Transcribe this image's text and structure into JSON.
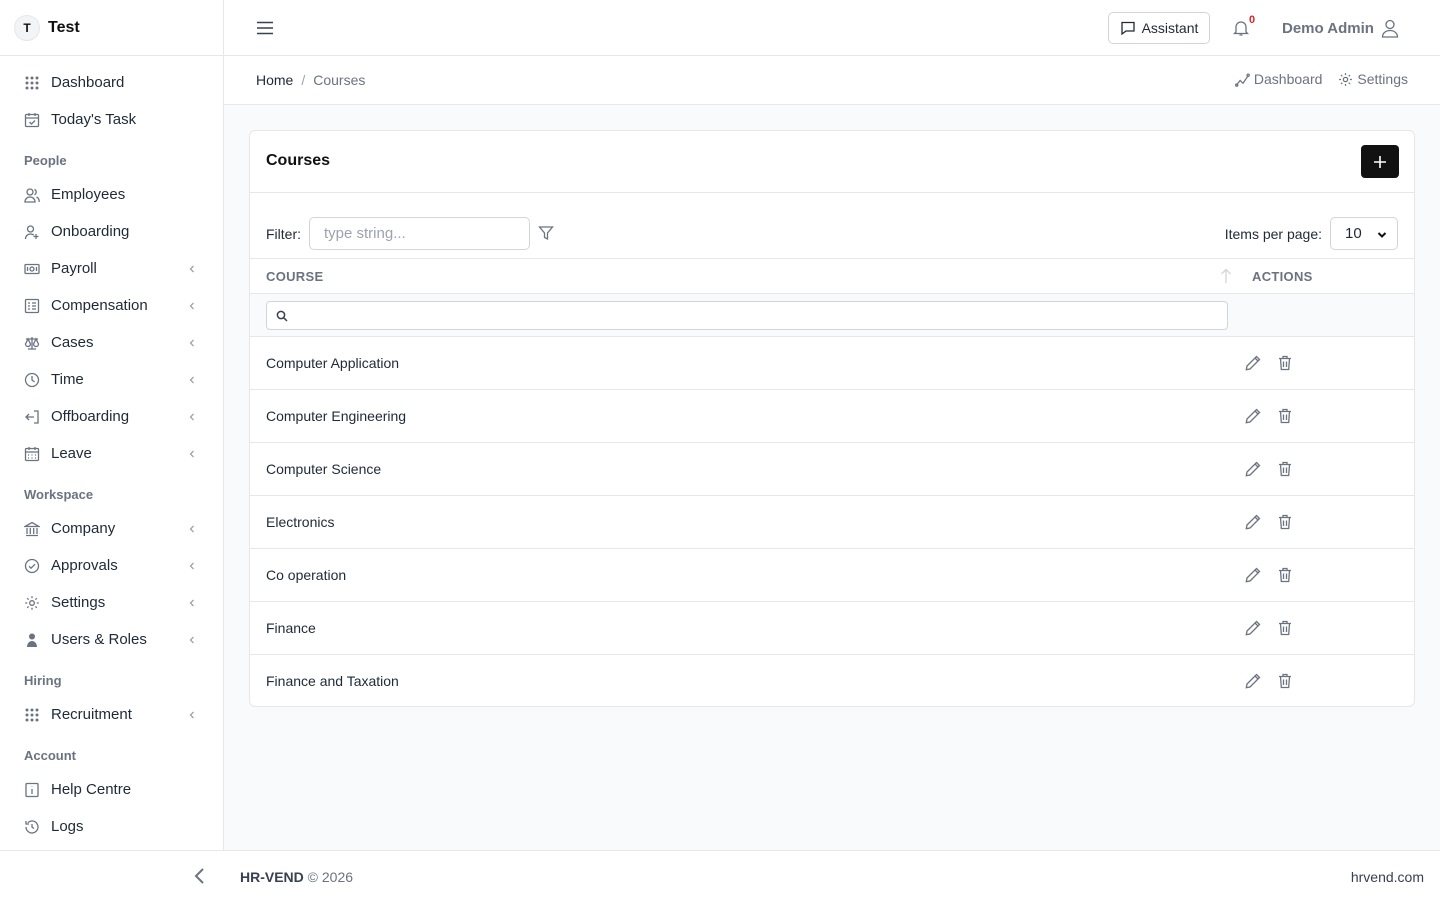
{
  "brand": {
    "initial": "T",
    "name": "Test"
  },
  "sidebar": {
    "top_items": [
      {
        "label": "Dashboard",
        "icon": "grid-icon"
      },
      {
        "label": "Today's Task",
        "icon": "calendar-check-icon"
      }
    ],
    "sections": [
      {
        "title": "People",
        "items": [
          {
            "label": "Employees",
            "icon": "users-icon",
            "chevron": false
          },
          {
            "label": "Onboarding",
            "icon": "user-plus-icon",
            "chevron": false
          },
          {
            "label": "Payroll",
            "icon": "money-icon",
            "chevron": true
          },
          {
            "label": "Compensation",
            "icon": "list-icon",
            "chevron": true
          },
          {
            "label": "Cases",
            "icon": "scale-icon",
            "chevron": true
          },
          {
            "label": "Time",
            "icon": "clock-icon",
            "chevron": true
          },
          {
            "label": "Offboarding",
            "icon": "logout-icon",
            "chevron": true
          },
          {
            "label": "Leave",
            "icon": "calendar-icon",
            "chevron": true
          }
        ]
      },
      {
        "title": "Workspace",
        "items": [
          {
            "label": "Company",
            "icon": "bank-icon",
            "chevron": true
          },
          {
            "label": "Approvals",
            "icon": "check-circle-icon",
            "chevron": true
          },
          {
            "label": "Settings",
            "icon": "gear-icon",
            "chevron": true
          },
          {
            "label": "Users & Roles",
            "icon": "user-shield-icon",
            "chevron": true
          }
        ]
      },
      {
        "title": "Hiring",
        "items": [
          {
            "label": "Recruitment",
            "icon": "grid-icon",
            "chevron": true
          }
        ]
      },
      {
        "title": "Account",
        "items": [
          {
            "label": "Help Centre",
            "icon": "info-icon",
            "chevron": false
          },
          {
            "label": "Logs",
            "icon": "history-icon",
            "chevron": false
          }
        ]
      }
    ]
  },
  "header": {
    "assistant_label": "Assistant",
    "notification_count": "0",
    "user_name": "Demo Admin"
  },
  "breadcrumb": {
    "home": "Home",
    "separator": "/",
    "current": "Courses",
    "quick_links": [
      {
        "label": "Dashboard",
        "icon": "chart-line-icon"
      },
      {
        "label": "Settings",
        "icon": "gear-icon"
      }
    ]
  },
  "card": {
    "title": "Courses",
    "filter_label": "Filter:",
    "filter_placeholder": "type string...",
    "items_per_page_label": "Items per page:",
    "items_per_page_value": "10",
    "columns": {
      "course": "COURSE",
      "actions": "ACTIONS"
    },
    "rows": [
      "Computer Application",
      "Computer Engineering",
      "Computer Science",
      "Electronics",
      "Co operation",
      "Finance",
      "Finance and Taxation"
    ]
  },
  "footer": {
    "brand": "HR-VEND",
    "copyright": "© 2026",
    "site": "hrvend.com"
  }
}
